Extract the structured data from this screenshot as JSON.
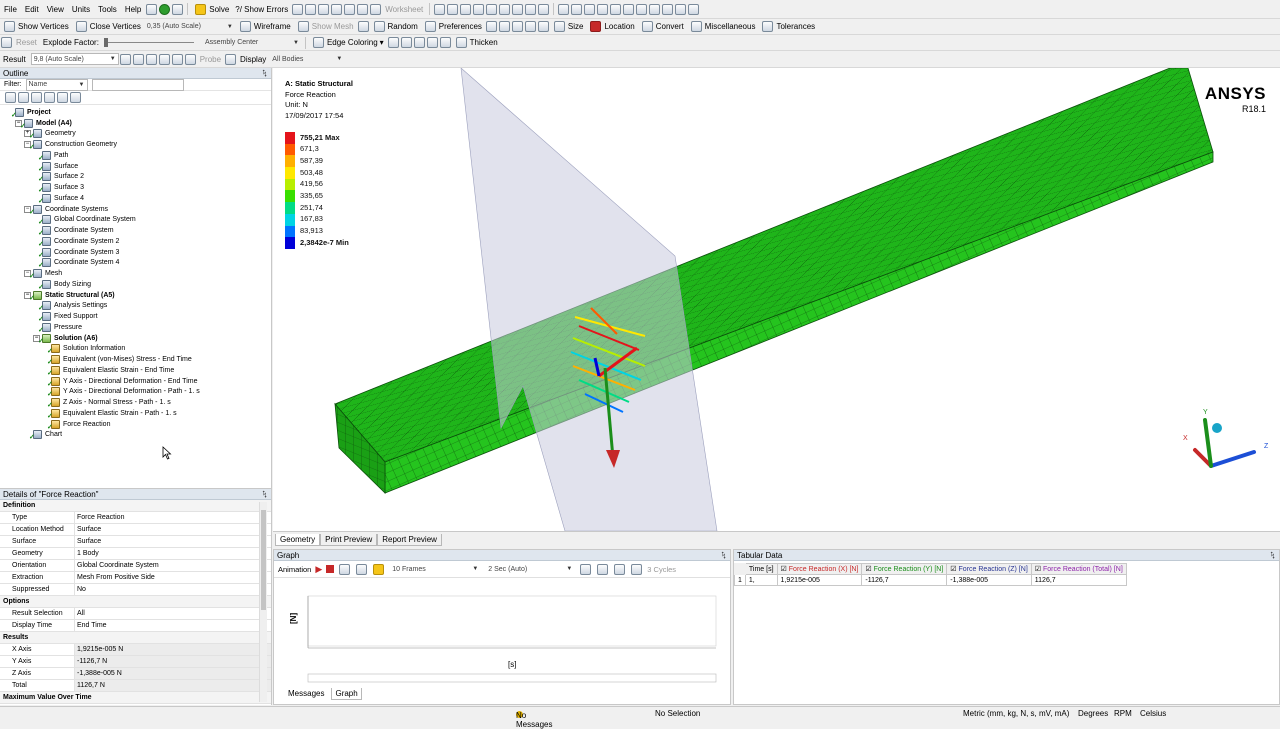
{
  "menubar": {
    "items": [
      "File",
      "Edit",
      "View",
      "Units",
      "Tools",
      "Help"
    ],
    "solve_label": "Solve",
    "show_errors_label": "?/ Show Errors",
    "worksheet_label": "Worksheet"
  },
  "toolbar2": {
    "show_vertices": "Show Vertices",
    "close_vertices": "Close Vertices",
    "vertex_scale": "0,35 (Auto Scale)",
    "wireframe": "Wireframe",
    "show_mesh": "Show Mesh",
    "random": "Random",
    "preferences": "Preferences",
    "size": "Size",
    "location": "Location",
    "convert": "Convert",
    "miscellaneous": "Miscellaneous",
    "tolerances": "Tolerances"
  },
  "toolbar3": {
    "reset": "Reset",
    "explode_factor": "Explode Factor:",
    "assembly_center": "Assembly Center",
    "edge_coloring": "Edge Coloring",
    "thicken": "Thicken"
  },
  "toolbar4": {
    "result_label": "Result",
    "result_scale": "9,8 (Auto Scale)",
    "probe": "Probe",
    "display": "Display",
    "all_bodies": "All Bodies"
  },
  "outline": {
    "title": "Outline",
    "filter_label": "Filter:",
    "filter_value": "Name",
    "tree": [
      {
        "label": "Project",
        "level": 0,
        "bold": true,
        "exp": ""
      },
      {
        "label": "Model (A4)",
        "level": 1,
        "bold": true,
        "exp": "−"
      },
      {
        "label": "Geometry",
        "level": 2,
        "bold": false,
        "exp": "+"
      },
      {
        "label": "Construction Geometry",
        "level": 2,
        "bold": false,
        "exp": "−"
      },
      {
        "label": "Path",
        "level": 3,
        "bold": false,
        "exp": ""
      },
      {
        "label": "Surface",
        "level": 3,
        "bold": false,
        "exp": ""
      },
      {
        "label": "Surface 2",
        "level": 3,
        "bold": false,
        "exp": ""
      },
      {
        "label": "Surface 3",
        "level": 3,
        "bold": false,
        "exp": ""
      },
      {
        "label": "Surface 4",
        "level": 3,
        "bold": false,
        "exp": ""
      },
      {
        "label": "Coordinate Systems",
        "level": 2,
        "bold": false,
        "exp": "−"
      },
      {
        "label": "Global Coordinate System",
        "level": 3,
        "bold": false,
        "exp": ""
      },
      {
        "label": "Coordinate System",
        "level": 3,
        "bold": false,
        "exp": ""
      },
      {
        "label": "Coordinate System 2",
        "level": 3,
        "bold": false,
        "exp": ""
      },
      {
        "label": "Coordinate System 3",
        "level": 3,
        "bold": false,
        "exp": ""
      },
      {
        "label": "Coordinate System 4",
        "level": 3,
        "bold": false,
        "exp": ""
      },
      {
        "label": "Mesh",
        "level": 2,
        "bold": false,
        "exp": "−"
      },
      {
        "label": "Body Sizing",
        "level": 3,
        "bold": false,
        "exp": ""
      },
      {
        "label": "Static Structural (A5)",
        "level": 2,
        "bold": true,
        "exp": "−"
      },
      {
        "label": "Analysis Settings",
        "level": 3,
        "bold": false,
        "exp": ""
      },
      {
        "label": "Fixed Support",
        "level": 3,
        "bold": false,
        "exp": ""
      },
      {
        "label": "Pressure",
        "level": 3,
        "bold": false,
        "exp": ""
      },
      {
        "label": "Solution (A6)",
        "level": 3,
        "bold": true,
        "exp": "−"
      },
      {
        "label": "Solution Information",
        "level": 4,
        "bold": false,
        "exp": ""
      },
      {
        "label": "Equivalent (von-Mises) Stress - End Time",
        "level": 4,
        "bold": false,
        "exp": ""
      },
      {
        "label": "Equivalent Elastic Strain - End Time",
        "level": 4,
        "bold": false,
        "exp": ""
      },
      {
        "label": "Y Axis - Directional Deformation - End Time",
        "level": 4,
        "bold": false,
        "exp": ""
      },
      {
        "label": "Y Axis - Directional Deformation - Path - 1. s",
        "level": 4,
        "bold": false,
        "exp": ""
      },
      {
        "label": "Z Axis - Normal Stress - Path - 1. s",
        "level": 4,
        "bold": false,
        "exp": ""
      },
      {
        "label": "Equivalent Elastic Strain - Path - 1. s",
        "level": 4,
        "bold": false,
        "exp": ""
      },
      {
        "label": "Force Reaction",
        "level": 4,
        "bold": false,
        "exp": ""
      },
      {
        "label": "Chart",
        "level": 2,
        "bold": false,
        "exp": ""
      }
    ]
  },
  "details": {
    "title": "Details of \"Force Reaction\"",
    "sections": [
      {
        "name": "Definition",
        "rows": [
          {
            "k": "Type",
            "v": "Force Reaction"
          },
          {
            "k": "Location Method",
            "v": "Surface"
          },
          {
            "k": "Surface",
            "v": "Surface"
          },
          {
            "k": "Geometry",
            "v": "1 Body"
          },
          {
            "k": "Orientation",
            "v": "Global Coordinate System"
          },
          {
            "k": "Extraction",
            "v": "Mesh From Positive Side"
          },
          {
            "k": "Suppressed",
            "v": "No"
          }
        ]
      },
      {
        "name": "Options",
        "rows": [
          {
            "k": "Result Selection",
            "v": "All"
          },
          {
            "k": "Display Time",
            "v": "End Time"
          }
        ]
      },
      {
        "name": "Results",
        "rows": [
          {
            "k": "X Axis",
            "v": "1,9215e-005 N"
          },
          {
            "k": "Y Axis",
            "v": "-1126,7 N"
          },
          {
            "k": "Z Axis",
            "v": "-1,388e-005 N"
          },
          {
            "k": "Total",
            "v": "1126,7 N"
          }
        ]
      },
      {
        "name": "Maximum Value Over Time",
        "rows": []
      }
    ]
  },
  "viewport": {
    "header": [
      "A: Static Structural",
      "Force Reaction",
      "Unit: N",
      "17/09/2017 17:54"
    ],
    "legend": [
      {
        "label": "755,21 Max",
        "color": "#e4141b"
      },
      {
        "label": "671,3",
        "color": "#ff5a00"
      },
      {
        "label": "587,39",
        "color": "#ffb000"
      },
      {
        "label": "503,48",
        "color": "#ffe800"
      },
      {
        "label": "419,56",
        "color": "#b8ee00"
      },
      {
        "label": "335,65",
        "color": "#39df00"
      },
      {
        "label": "251,74",
        "color": "#00dc86"
      },
      {
        "label": "167,83",
        "color": "#00d4e4"
      },
      {
        "label": "83,913",
        "color": "#0074ff"
      },
      {
        "label": "2,3842e-7 Min",
        "color": "#0000d8"
      }
    ],
    "brand": "ANSYS",
    "version": "R18.1",
    "axes": {
      "x": "X",
      "y": "Y",
      "z": "Z"
    }
  },
  "view_tabs": [
    "Geometry",
    "Print Preview",
    "Report Preview"
  ],
  "graph": {
    "title": "Graph",
    "animation": "Animation",
    "frames": "10 Frames",
    "duration": "2 Sec (Auto)",
    "cycles": "3 Cycles",
    "ylabel": "[N]",
    "xlabel": "[s]"
  },
  "tabular": {
    "title": "Tabular Data",
    "columns": [
      "Time [s]",
      "Force Reaction (X) [N]",
      "Force Reaction (Y) [N]",
      "Force Reaction (Z) [N]",
      "Force Reaction (Total) [N]"
    ],
    "column_colors": [
      "#000000",
      "#c62828",
      "#1b8e1b",
      "#283593",
      "#8e24aa"
    ],
    "row": {
      "index": "1",
      "time": "1,",
      "x": "1,9215e-005",
      "y": "-1126,7",
      "z": "-1,388e-005",
      "total": "1126,7"
    }
  },
  "bottom_tabs": [
    "Messages",
    "Graph"
  ],
  "status": {
    "messages": "No Messages",
    "selection": "No Selection",
    "units": "Metric (mm, kg, N, s, mV, mA)",
    "angle": "Degrees",
    "speed": "RPM",
    "temp": "Celsius"
  },
  "colors": {
    "mesh": "#1fb51a",
    "plane": "#c8cbde"
  }
}
